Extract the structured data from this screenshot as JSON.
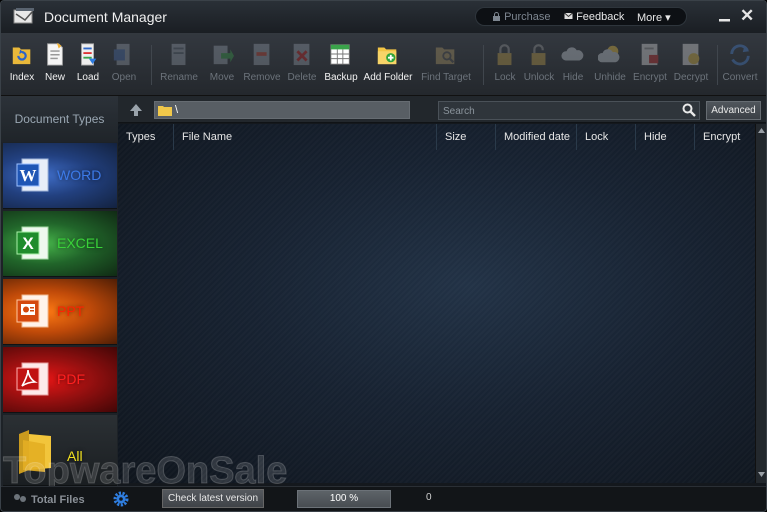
{
  "window": {
    "title": "Document Manager",
    "top_links": {
      "purchase": "Purchase",
      "feedback": "Feedback",
      "more": "More"
    }
  },
  "toolbar": {
    "buttons": [
      {
        "label": "Index",
        "icon": "refresh-folder-icon",
        "enabled": true
      },
      {
        "label": "New",
        "icon": "new-document-icon",
        "enabled": true
      },
      {
        "label": "Load",
        "icon": "load-document-icon",
        "enabled": true
      },
      {
        "label": "Open",
        "icon": "open-document-icon",
        "enabled": false
      },
      {
        "label": "Rename",
        "icon": "rename-icon",
        "enabled": false
      },
      {
        "label": "Move",
        "icon": "move-icon",
        "enabled": false
      },
      {
        "label": "Remove",
        "icon": "remove-icon",
        "enabled": false
      },
      {
        "label": "Delete",
        "icon": "delete-icon",
        "enabled": false
      },
      {
        "label": "Backup",
        "icon": "backup-icon",
        "enabled": true
      },
      {
        "label": "Add Folder",
        "icon": "add-folder-icon",
        "enabled": true
      },
      {
        "label": "Find Target",
        "icon": "find-target-icon",
        "enabled": false
      },
      {
        "label": "Lock",
        "icon": "lock-icon",
        "enabled": false
      },
      {
        "label": "Unlock",
        "icon": "unlock-icon",
        "enabled": false
      },
      {
        "label": "Hide",
        "icon": "hide-cloud-icon",
        "enabled": false
      },
      {
        "label": "Unhide",
        "icon": "unhide-cloud-icon",
        "enabled": false
      },
      {
        "label": "Encrypt",
        "icon": "encrypt-icon",
        "enabled": false
      },
      {
        "label": "Decrypt",
        "icon": "decrypt-icon",
        "enabled": false
      },
      {
        "label": "Convert",
        "icon": "convert-icon",
        "enabled": false
      }
    ]
  },
  "sidebar": {
    "title": "Document Types",
    "categories": [
      {
        "label": "WORD",
        "color": "#3c7ae8",
        "icon": "word-icon"
      },
      {
        "label": "EXCEL",
        "color": "#39d239",
        "icon": "excel-icon"
      },
      {
        "label": "PPT",
        "color": "#ff2200",
        "icon": "powerpoint-icon"
      },
      {
        "label": "PDF",
        "color": "#ff2020",
        "icon": "pdf-icon"
      },
      {
        "label": "All",
        "color": "#f0e020",
        "icon": "folder-icon"
      }
    ]
  },
  "pathbar": {
    "path": "\\",
    "search_placeholder": "Search",
    "advanced_label": "Advanced"
  },
  "table": {
    "columns": [
      "Types",
      "File Name",
      "Size",
      "Modified date",
      "Lock",
      "Hide",
      "Encrypt"
    ],
    "rows": []
  },
  "statusbar": {
    "total_files_label": "Total Files",
    "check_version_label": "Check latest version",
    "zoom": "100 %",
    "count": "0"
  },
  "watermark": {
    "text": "TopwareOnSale"
  },
  "colors": {
    "accent": "#2f6fd6",
    "background": "#14181d"
  }
}
